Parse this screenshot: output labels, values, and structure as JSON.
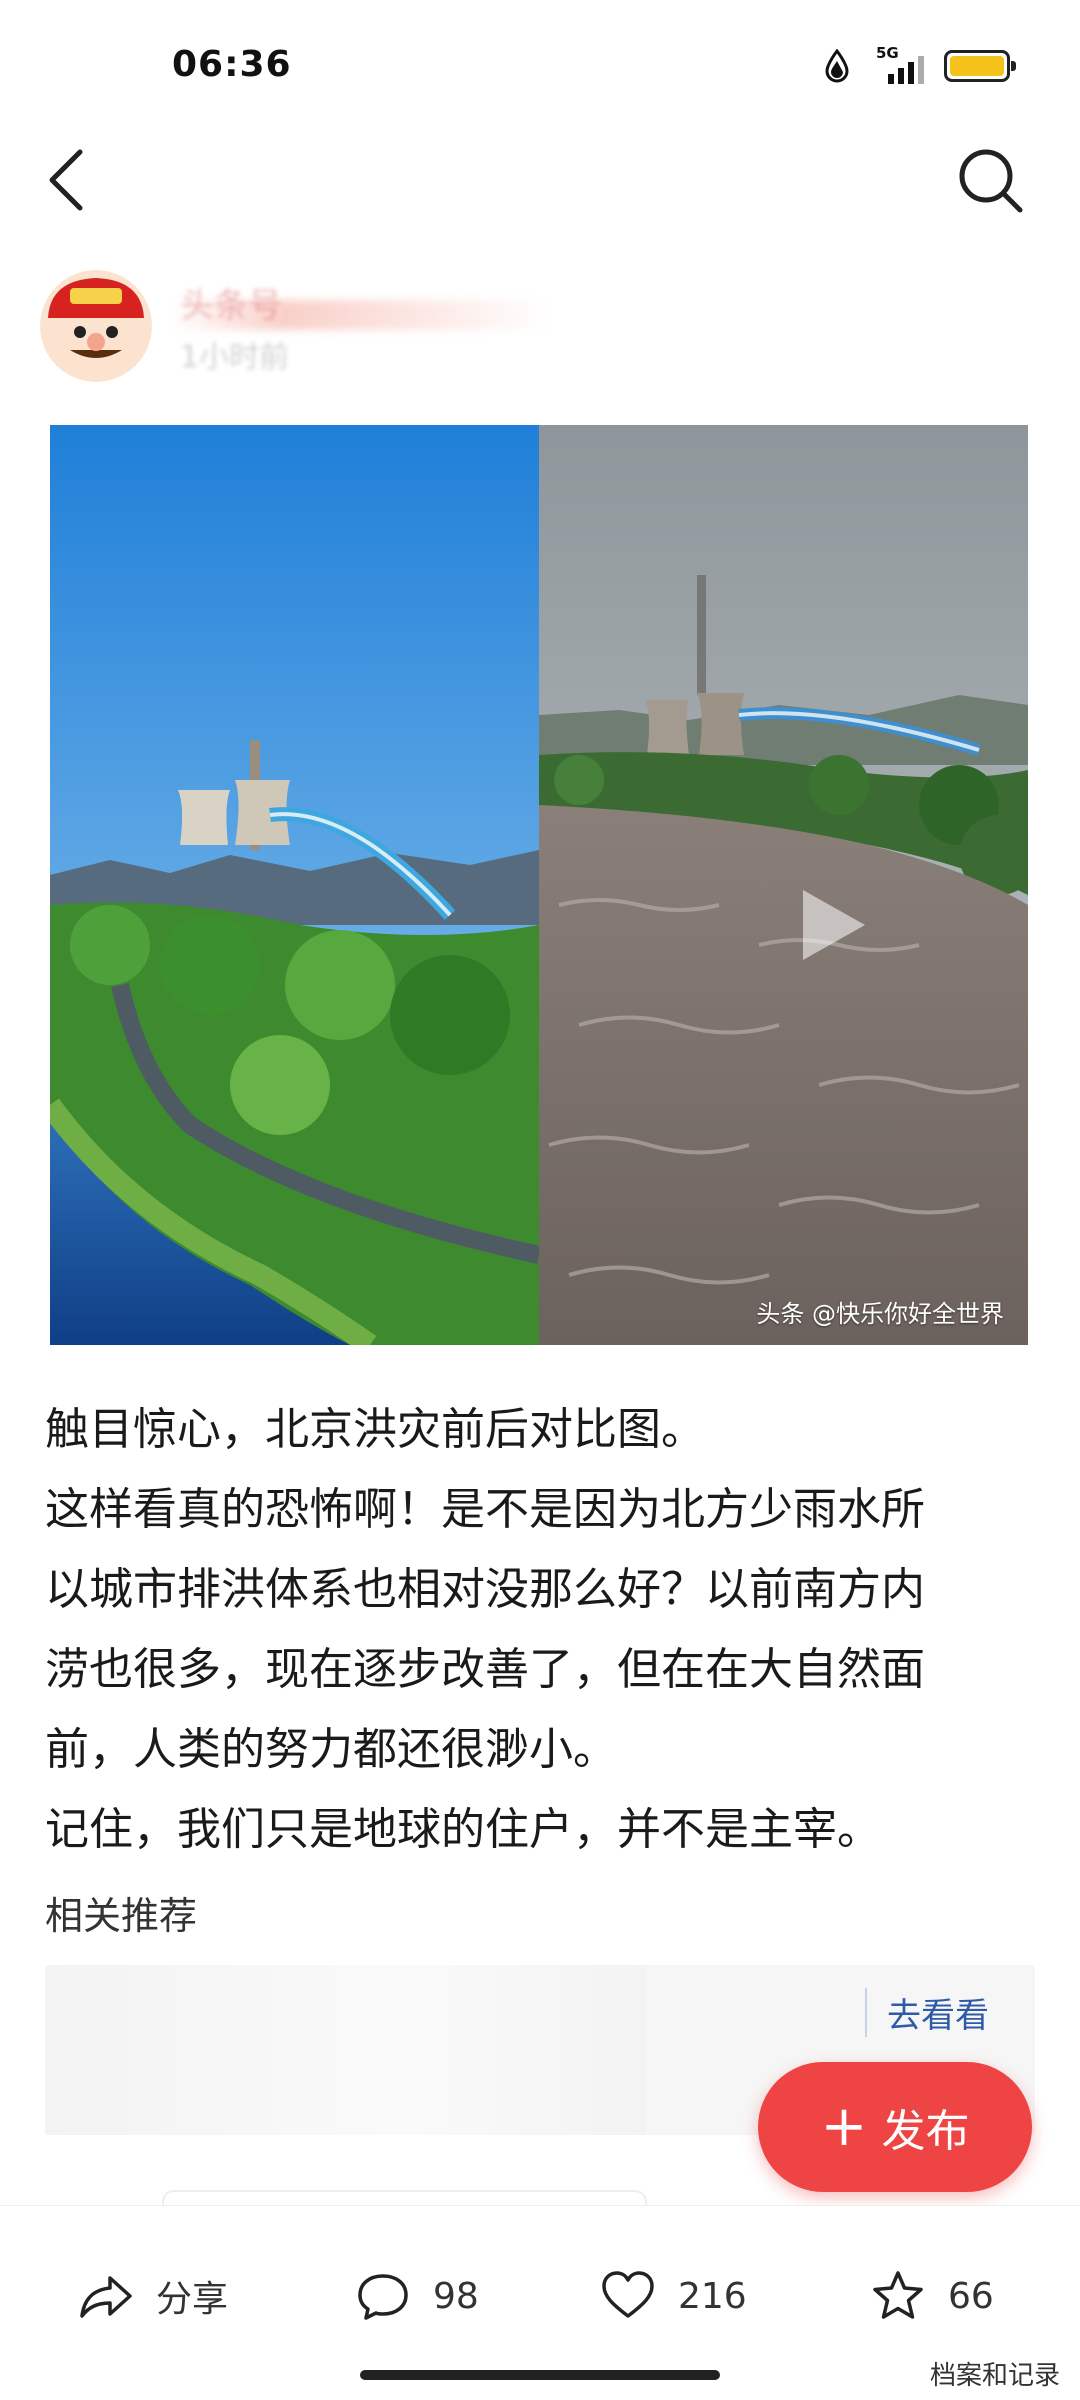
{
  "status_bar": {
    "time": "06:36",
    "network": "5G",
    "battery_color": "#f5c21b"
  },
  "nav": {
    "back_icon": "chevron-left-icon",
    "search_icon": "search-icon"
  },
  "author": {
    "name": "头条号",
    "time": "1小时前"
  },
  "media": {
    "watermark": "头条 @快乐你好全世界",
    "has_play_button": true
  },
  "post": {
    "lines": [
      "触目惊心，北京洪灾前后对比图。",
      "这样看真的恐怖啊！是不是因为北方少雨水所",
      "以城市排洪体系也相对没那么好？以前南方内",
      "涝也很多，现在逐步改善了，但在在大自然面",
      "前，人类的努力都还很渺小。",
      "记住，我们只是地球的住户，并不是主宰。"
    ]
  },
  "related": {
    "title": "相关推荐",
    "link": "去看看"
  },
  "publish": {
    "label": "发布",
    "plus": "+",
    "color": "#ee4444"
  },
  "actions": {
    "share_label": "分享",
    "comments": "98",
    "likes": "216",
    "favorites": "66"
  },
  "corner_mark": "档案和记录"
}
